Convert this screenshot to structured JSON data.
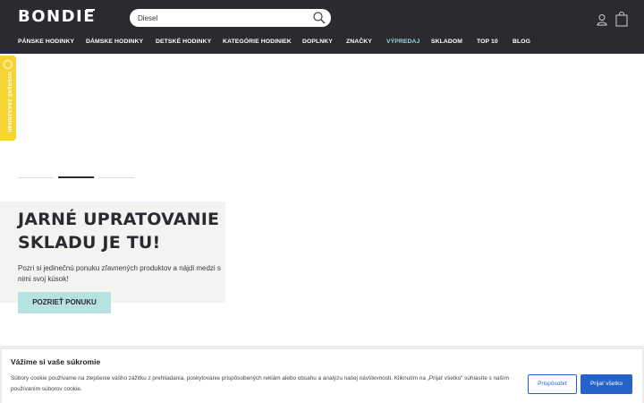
{
  "header": {
    "logo_text": "BONDIE",
    "search": {
      "value": "Diesel"
    },
    "nav": [
      {
        "label": "PÁNSKE HODINKY"
      },
      {
        "label": "DÁMSKE HODINKY"
      },
      {
        "label": "DETSKÉ HODINKY"
      },
      {
        "label": "KATEGÓRIE HODINIEK"
      },
      {
        "label": "DOPLNKY"
      },
      {
        "label": "ZNAČKY"
      },
      {
        "label": "VÝPREDAJ"
      },
      {
        "label": "SKLADOM"
      },
      {
        "label": "TOP 10"
      },
      {
        "label": "BLOG"
      }
    ]
  },
  "side_badge": {
    "label": "OVERENÉ ZÁKAZNÍKMI"
  },
  "slider": {
    "slide_count": 3,
    "active_index": 1
  },
  "promo": {
    "title": "JARNÉ UPRATOVANIE SKLADU JE TU!",
    "text": "Pozri si jedinečnú ponuku zľavnených produktov a nájdi medzi s nimi svoj kúsok!",
    "button": "POZRIEŤ PONUKU"
  },
  "cookie": {
    "title": "Vážime si vaše súkromie",
    "text": "Súbory cookie používame na zlepšenie vášho zážitku z prehliadania, poskytovanie prispôsobených reklám alebo obsahu a analýzu našej návštevnosti. Kliknutím na „Prijať všetko“ súhlasíte s naším používaním súborov cookie.",
    "customize": "Prispôsobiť",
    "accept": "Prijať všetko"
  },
  "colors": {
    "header_bg": "#2a2b31",
    "sale_accent": "#9cd7da",
    "badge": "#f6d433",
    "promo_button": "#b6e2e2",
    "cookie_button": "#2463c9"
  },
  "icons": [
    "search-icon",
    "user-icon",
    "shopping-bag-icon",
    "shield-check-icon"
  ]
}
